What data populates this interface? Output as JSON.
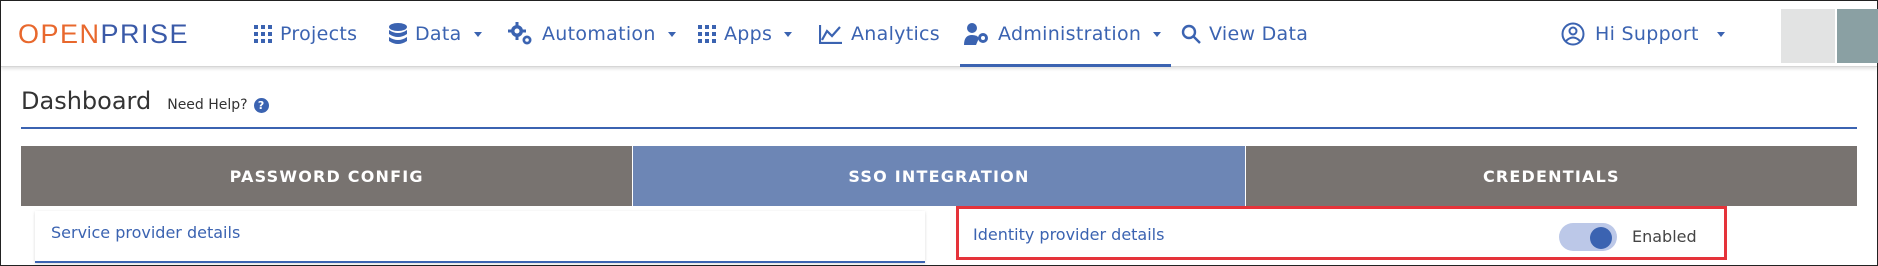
{
  "brand": {
    "part1": "OPEN",
    "part2": "PRISE"
  },
  "nav": {
    "projects": "Projects",
    "data": "Data",
    "automation": "Automation",
    "apps": "Apps",
    "analytics": "Analytics",
    "administration": "Administration",
    "view_data": "View Data"
  },
  "user": {
    "greeting": "Hi Support"
  },
  "page": {
    "title": "Dashboard",
    "help": "Need Help?",
    "help_icon": "?"
  },
  "tabs": [
    {
      "label": "PASSWORD CONFIG",
      "selected": false
    },
    {
      "label": "SSO INTEGRATION",
      "selected": true
    },
    {
      "label": "CREDENTIALS",
      "selected": false
    }
  ],
  "panels": {
    "service_provider": "Service provider details",
    "identity_provider": "Identity provider details",
    "toggle_state": "Enabled"
  },
  "colors": {
    "accent": "#3b63b1",
    "brand_orange": "#e8682d",
    "tab_gray": "#787370",
    "tab_selected": "#6d86b5",
    "highlight": "#e5333a"
  }
}
